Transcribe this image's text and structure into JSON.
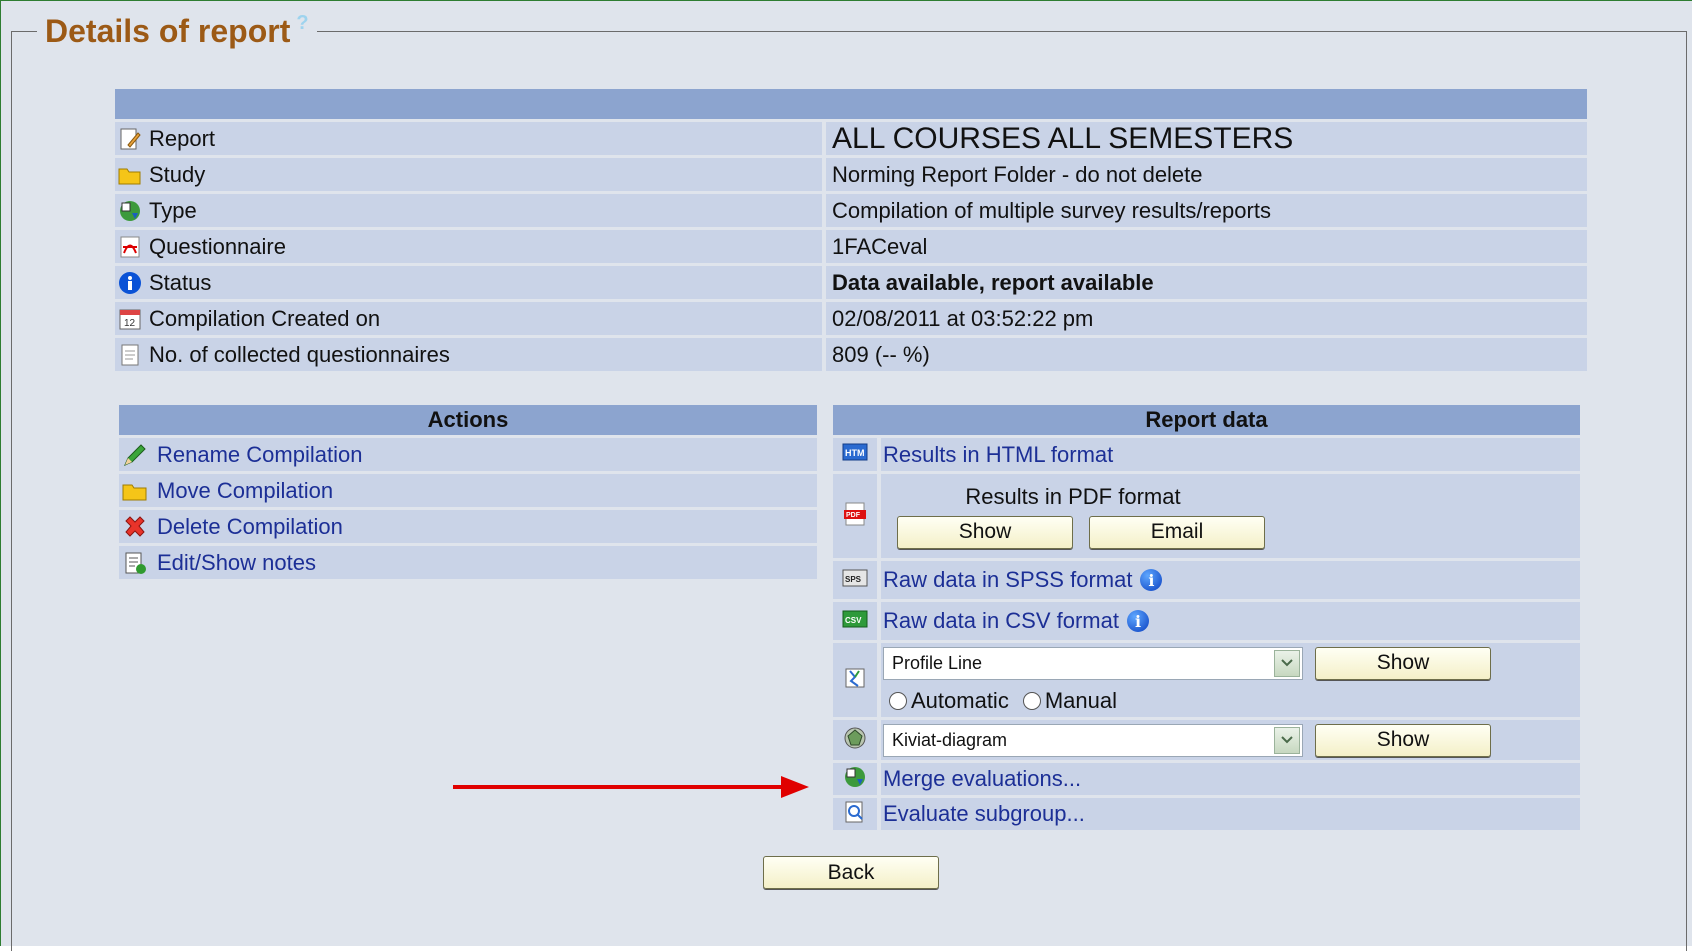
{
  "legend": {
    "title": "Details of report",
    "help": "?"
  },
  "details": [
    {
      "label": "Report",
      "value": "ALL COURSES ALL SEMESTERS",
      "icon": "report-icon"
    },
    {
      "label": "Study",
      "value": "Norming Report Folder - do not delete",
      "icon": "folder-icon"
    },
    {
      "label": "Type",
      "value": "Compilation of multiple survey results/reports",
      "icon": "type-icon"
    },
    {
      "label": "Questionnaire",
      "value": "1FACeval",
      "icon": "pdf-icon"
    },
    {
      "label": "Status",
      "value": "Data available, report available",
      "icon": "info-icon"
    },
    {
      "label": "Compilation Created on",
      "value": "02/08/2011 at 03:52:22 pm",
      "icon": "calendar-icon"
    },
    {
      "label": "No. of collected questionnaires",
      "value": "809 (-- %)",
      "icon": "document-icon"
    }
  ],
  "actions": {
    "header": "Actions",
    "items": [
      {
        "label": "Rename Compilation",
        "icon": "pencil-icon"
      },
      {
        "label": "Move Compilation",
        "icon": "folder-icon"
      },
      {
        "label": "Delete Compilation",
        "icon": "delete-x-icon"
      },
      {
        "label": "Edit/Show notes",
        "icon": "notes-icon"
      }
    ]
  },
  "report_data": {
    "header": "Report data",
    "html_results": "Results in HTML format",
    "pdf_results": "Results in PDF format",
    "pdf_show": "Show",
    "pdf_email": "Email",
    "spss": "Raw data in SPSS format",
    "csv": "Raw data in CSV format",
    "profile_select": "Profile Line",
    "profile_show": "Show",
    "radio_automatic": "Automatic",
    "radio_manual": "Manual",
    "kiviat_select": "Kiviat-diagram",
    "kiviat_show": "Show",
    "merge": "Merge evaluations...",
    "subgroup": "Evaluate subgroup..."
  },
  "back_button": "Back",
  "colors": {
    "header_bg": "#8ca4cf",
    "row_bg": "#c9d3e7",
    "link": "#1c2f96",
    "status_green": "#1f9a1f",
    "title_brown": "#9c5a16",
    "arrow_red": "#e00000"
  }
}
